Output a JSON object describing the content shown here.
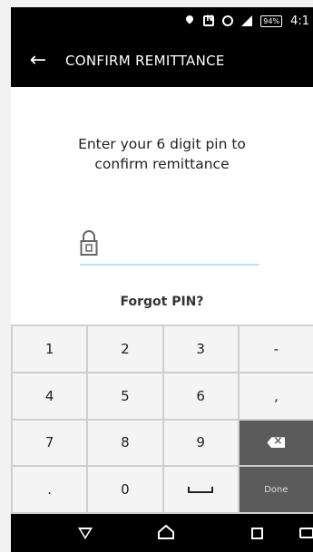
{
  "status_bar": {
    "battery": "94%",
    "time": "4:1"
  },
  "app_bar": {
    "back_label": "←",
    "title": "CONFIRM REMITTANCE"
  },
  "pin_prompt": {
    "line1": "Enter your 6 digit pin to",
    "line2": "confirm remittance",
    "value": ""
  },
  "forgot_pin_label": "Forgot PIN?",
  "keypad": {
    "keys": [
      "1",
      "2",
      "3",
      "-",
      "4",
      "5",
      "6",
      ",",
      "7",
      "8",
      "9",
      "",
      ".",
      "0",
      "",
      "Done"
    ]
  },
  "colors": {
    "appbar_bg": "#000000",
    "pin_underline": "#bfe3e8",
    "dark_key": "#5b5b5b"
  }
}
